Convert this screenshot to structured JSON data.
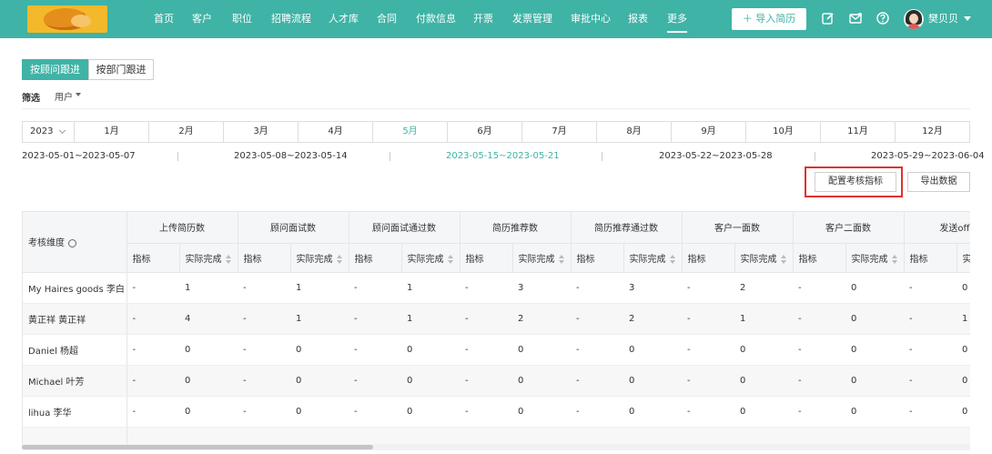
{
  "nav": {
    "items": [
      "首页",
      "客户",
      "职位",
      "招聘流程",
      "人才库",
      "合同",
      "付款信息",
      "开票",
      "发票管理",
      "审批中心",
      "报表",
      "更多"
    ],
    "active_index": 11,
    "import_label": "＋ 导入简历",
    "username": "樊贝贝",
    "icons": [
      "edit-icon",
      "mail-icon",
      "help-icon"
    ]
  },
  "tabs": {
    "by_consultant": "按顾问跟进",
    "by_department": "按部门跟进"
  },
  "filter": {
    "label": "筛选",
    "user": "用户"
  },
  "calendar": {
    "year": "2023",
    "months": [
      "1月",
      "2月",
      "3月",
      "4月",
      "5月",
      "6月",
      "7月",
      "8月",
      "9月",
      "10月",
      "11月",
      "12月"
    ],
    "active_month_index": 4,
    "weeks": [
      "2023-05-01~2023-05-07",
      "2023-05-08~2023-05-14",
      "2023-05-15~2023-05-21",
      "2023-05-22~2023-05-28",
      "2023-05-29~2023-06-04"
    ],
    "active_week_index": 2
  },
  "actions": {
    "config": "配置考核指标",
    "export": "导出数据"
  },
  "table": {
    "dimension_header": "考核维度",
    "groups": [
      "上传简历数",
      "顾问面试数",
      "顾问面试通过数",
      "简历推荐数",
      "简历推荐通过数",
      "客户一面数",
      "客户二面数",
      "发送offer"
    ],
    "sub_target": "指标",
    "sub_actual": "实际完成",
    "rows": [
      {
        "name": "My Haires goods 李白",
        "cells": [
          "-",
          "1",
          "-",
          "1",
          "-",
          "1",
          "-",
          "3",
          "-",
          "3",
          "-",
          "2",
          "-",
          "0",
          "-",
          "0"
        ]
      },
      {
        "name": "黄正祥 黄正祥",
        "cells": [
          "-",
          "4",
          "-",
          "1",
          "-",
          "1",
          "-",
          "2",
          "-",
          "2",
          "-",
          "1",
          "-",
          "0",
          "-",
          "1"
        ]
      },
      {
        "name": "Daniel 杨超",
        "cells": [
          "-",
          "0",
          "-",
          "0",
          "-",
          "0",
          "-",
          "0",
          "-",
          "0",
          "-",
          "0",
          "-",
          "0",
          "-",
          "0"
        ]
      },
      {
        "name": "Michael 叶芳",
        "cells": [
          "-",
          "0",
          "-",
          "0",
          "-",
          "0",
          "-",
          "0",
          "-",
          "0",
          "-",
          "0",
          "-",
          "0",
          "-",
          "0"
        ]
      },
      {
        "name": "lihua 李华",
        "cells": [
          "-",
          "0",
          "-",
          "0",
          "-",
          "0",
          "-",
          "0",
          "-",
          "0",
          "-",
          "0",
          "-",
          "0",
          "-",
          "0"
        ]
      },
      {
        "name": "",
        "cells": [
          "",
          "",
          "",
          "",
          "",
          "",
          "",
          "",
          "",
          "",
          "",
          "",
          "",
          "",
          "",
          ""
        ]
      }
    ]
  }
}
